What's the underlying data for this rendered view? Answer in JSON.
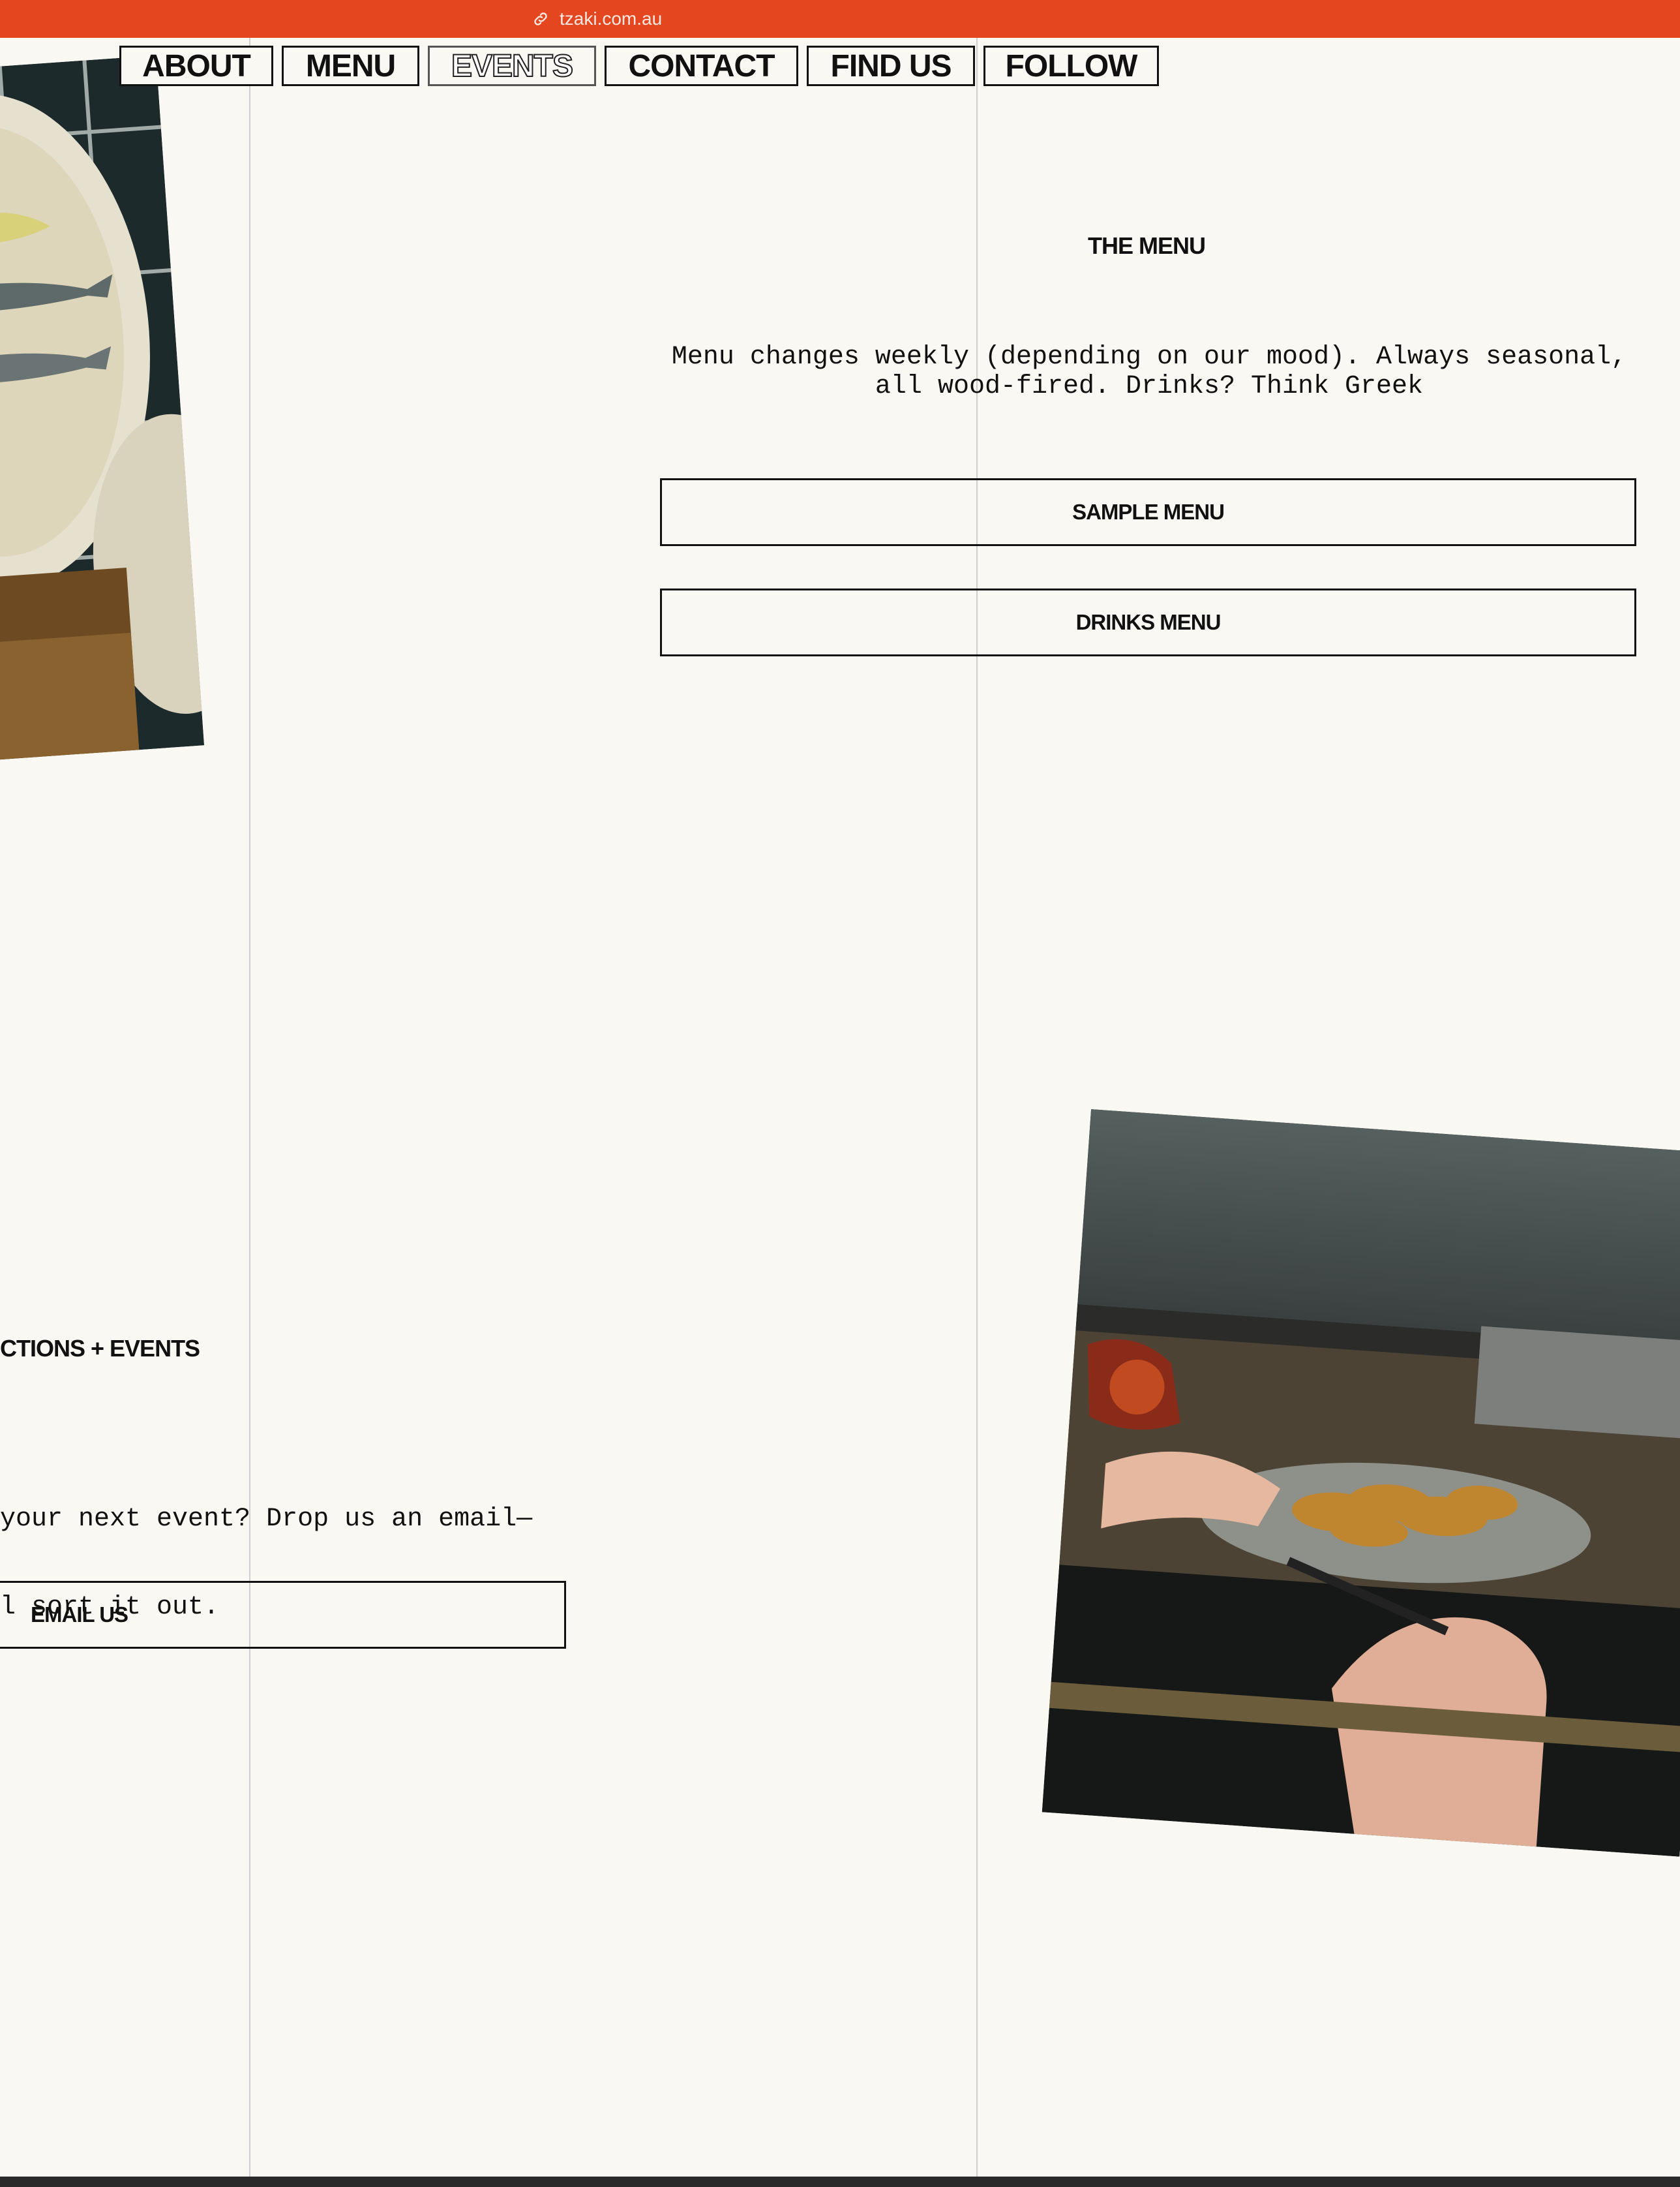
{
  "browser": {
    "url": "tzaki.com.au",
    "accent": "#e44620"
  },
  "nav": {
    "items": [
      {
        "label": "ABOUT"
      },
      {
        "label": "MENU"
      },
      {
        "label": "EVENTS"
      },
      {
        "label": "CONTACT"
      },
      {
        "label": "FIND US"
      },
      {
        "label": "FOLLOW"
      }
    ],
    "active": "EVENTS"
  },
  "menu_section": {
    "title": "THE MENU",
    "description_line1": "Menu changes weekly (depending on our mood). Always seasonal,",
    "description_line2": "all wood-fired. Drinks? Think Greek",
    "sample_menu_button": "SAMPLE MENU",
    "drinks_menu_button": "DRINKS MENU"
  },
  "events_section": {
    "title": "CTIONS + EVENTS",
    "description_line1": "your next event? Drop us an email—",
    "description_line2": "l sort it out.",
    "email_button": "EMAIL US"
  },
  "colors": {
    "background": "#faf8f2",
    "text": "#111111"
  }
}
